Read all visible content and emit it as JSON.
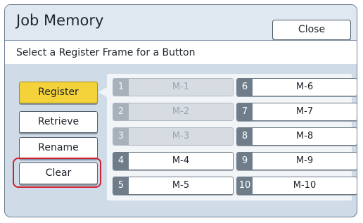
{
  "window": {
    "title": "Job Memory",
    "close_label": "Close"
  },
  "instruction": "Select a Register Frame for a Button",
  "side_buttons": [
    {
      "label": "Register",
      "active": true
    },
    {
      "label": "Retrieve",
      "active": false
    },
    {
      "label": "Rename",
      "active": false
    },
    {
      "label": "Clear",
      "active": false,
      "highlighted": true
    }
  ],
  "slots": [
    {
      "num": "1",
      "label": "M-1",
      "enabled": false
    },
    {
      "num": "2",
      "label": "M-2",
      "enabled": false
    },
    {
      "num": "3",
      "label": "M-3",
      "enabled": false
    },
    {
      "num": "4",
      "label": "M-4",
      "enabled": true
    },
    {
      "num": "5",
      "label": "M-5",
      "enabled": true
    },
    {
      "num": "6",
      "label": "M-6",
      "enabled": true
    },
    {
      "num": "7",
      "label": "M-7",
      "enabled": true
    },
    {
      "num": "8",
      "label": "M-8",
      "enabled": true
    },
    {
      "num": "9",
      "label": "M-9",
      "enabled": true
    },
    {
      "num": "10",
      "label": "M-10",
      "enabled": true
    }
  ],
  "colors": {
    "active_button": "#f4d33a",
    "highlight_ring": "#cf2035",
    "screen_background": "#cfdbe7"
  }
}
